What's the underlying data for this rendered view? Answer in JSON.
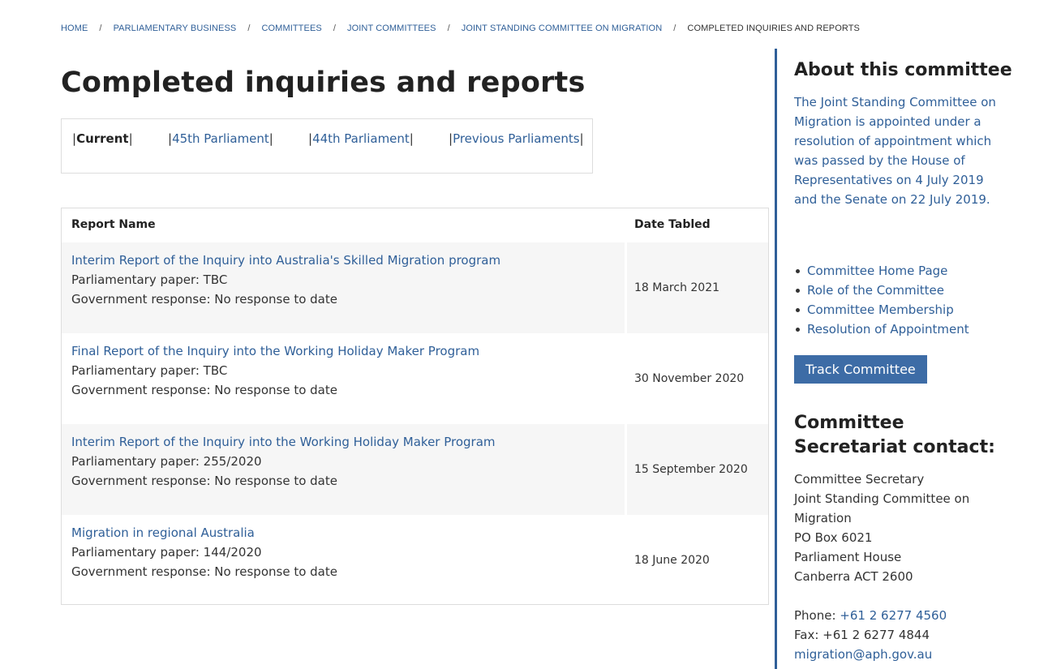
{
  "breadcrumb": [
    {
      "label": "HOME"
    },
    {
      "label": "PARLIAMENTARY BUSINESS"
    },
    {
      "label": "COMMITTEES"
    },
    {
      "label": "JOINT COMMITTEES"
    },
    {
      "label": "JOINT STANDING COMMITTEE ON MIGRATION"
    },
    {
      "label": "COMPLETED INQUIRIES AND REPORTS"
    }
  ],
  "breadcrumb_separator": "/",
  "page_title": "Completed inquiries and reports",
  "parliament_tabs": [
    {
      "label": "Current",
      "active": true
    },
    {
      "label": "45th Parliament",
      "active": false
    },
    {
      "label": "44th Parliament",
      "active": false
    },
    {
      "label": "Previous Parliaments",
      "active": false
    }
  ],
  "tab_bar_char": "|",
  "table": {
    "headers": {
      "name": "Report Name",
      "date": "Date Tabled"
    },
    "rows": [
      {
        "title": "Interim Report of the Inquiry into Australia's Skilled Migration program",
        "paper": "Parliamentary paper: TBC",
        "response": "Government response: No response to date",
        "date": "18 March 2021"
      },
      {
        "title": "Final Report of the Inquiry into the Working Holiday Maker Program",
        "paper": "Parliamentary paper: TBC",
        "response": "Government response: No response to date",
        "date": "30 November 2020"
      },
      {
        "title": "Interim Report of the Inquiry into the Working Holiday Maker Program",
        "paper": "Parliamentary paper: 255/2020",
        "response": "Government response: No response to date",
        "date": "15 September 2020"
      },
      {
        "title": "Migration in regional Australia",
        "paper": "Parliamentary paper: 144/2020",
        "response": "Government response: No response to date",
        "date": "18 June 2020"
      }
    ]
  },
  "sidebar": {
    "about_heading": "About this committee",
    "about_text": "The Joint Standing Committee on Migration is appointed under a resolution of appointment which was passed by the House of Representatives on 4 July 2019 and the Senate on 22 July 2019.",
    "links": [
      {
        "label": "Committee Home Page"
      },
      {
        "label": "Role of the Committee"
      },
      {
        "label": "Committee Membership"
      },
      {
        "label": "Resolution of Appointment"
      }
    ],
    "track_button": "Track Committee",
    "secretariat_heading": "Committee Secretariat contact:",
    "address_lines": [
      "Committee Secretary",
      "Joint Standing Committee on",
      "Migration",
      "PO Box 6021",
      "Parliament House",
      "Canberra ACT 2600"
    ],
    "phone_label": "Phone: ",
    "phone": "+61 2 6277 4560",
    "fax": "Fax: +61 2 6277 4844",
    "email": "migration@aph.gov.au"
  },
  "colors": {
    "link": "#2f5f98",
    "accent_rule": "#2f5f98",
    "button": "#3d6ca6",
    "row_shade": "#f6f6f6"
  }
}
